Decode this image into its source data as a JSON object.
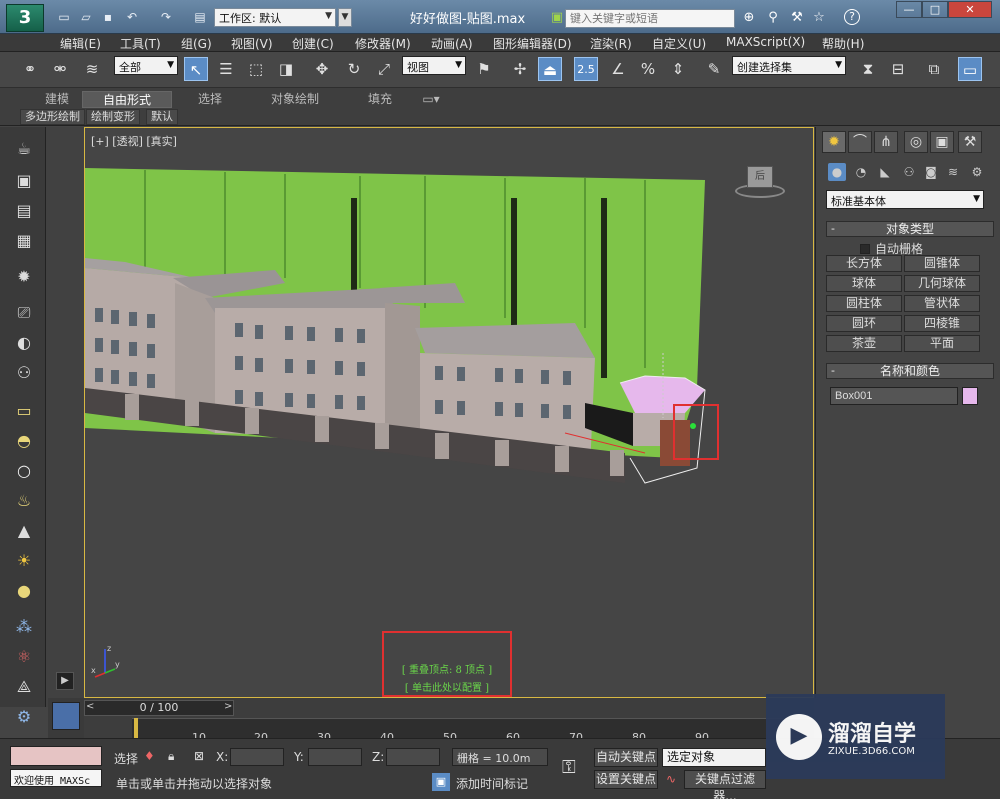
{
  "titlebar": {
    "logo_text": "3",
    "workspace_label": "工作区: 默认",
    "document_title": "好好做图-贴图.max",
    "search_placeholder": "键入关键字或短语",
    "help_label": "?"
  },
  "menu": [
    {
      "label": "编辑(E)"
    },
    {
      "label": "工具(T)"
    },
    {
      "label": "组(G)"
    },
    {
      "label": "视图(V)"
    },
    {
      "label": "创建(C)"
    },
    {
      "label": "修改器(M)"
    },
    {
      "label": "动画(A)"
    },
    {
      "label": "图形编辑器(D)"
    },
    {
      "label": "渲染(R)"
    },
    {
      "label": "自定义(U)"
    },
    {
      "label": "MAXScript(X)"
    },
    {
      "label": "帮助(H)"
    }
  ],
  "toolbar": {
    "selection_filter": "全部",
    "ref_coord": "视图",
    "snap_value": "2.5",
    "named_selection": "创建选择集"
  },
  "ribbon": {
    "tabs": [
      {
        "label": "建模"
      },
      {
        "label": "自由形式"
      },
      {
        "label": "选择"
      },
      {
        "label": "对象绘制"
      },
      {
        "label": "填充"
      }
    ],
    "subtabs": [
      {
        "label": "多边形绘制"
      },
      {
        "label": "绘制变形"
      },
      {
        "label": "默认"
      }
    ]
  },
  "viewport": {
    "label": "[+] [透视] [真实]",
    "viewcube_face": "后",
    "info_line1": "[ 重叠顶点: 8 顶点 ]",
    "info_line2": "[ 单击此处以配置 ]",
    "axis_x": "x",
    "axis_y": "y",
    "axis_z": "z"
  },
  "command_panel": {
    "category": "标准基本体",
    "object_type_title": "对象类型",
    "autogrid_label": "自动栅格",
    "object_buttons": [
      {
        "label": "长方体"
      },
      {
        "label": "圆锥体"
      },
      {
        "label": "球体"
      },
      {
        "label": "几何球体"
      },
      {
        "label": "圆柱体"
      },
      {
        "label": "管状体"
      },
      {
        "label": "圆环"
      },
      {
        "label": "四棱锥"
      },
      {
        "label": "茶壶"
      },
      {
        "label": "平面"
      }
    ],
    "name_color_title": "名称和颜色",
    "object_name": "Box001",
    "object_color": "#e6b8ec"
  },
  "timeline": {
    "slider_label": "0 / 100",
    "ticks": [
      "10",
      "20",
      "30",
      "40",
      "50",
      "60",
      "70",
      "80",
      "90"
    ]
  },
  "statusbar": {
    "welcome_text": "欢迎使用 MAXSc",
    "selection_label": "选择",
    "x_label": "X:",
    "y_label": "Y:",
    "z_label": "Z:",
    "grid_label": "栅格 = 10.0m",
    "auto_key_label": "自动关键点",
    "set_key_label": "设置关键点",
    "selected_object_label": "选定对象",
    "key_filter_label": "关键点过滤器...",
    "prompt_text": "单击或单击并拖动以选择对象",
    "add_time_tag_label": "添加时间标记"
  },
  "watermark": {
    "title": "溜溜自学",
    "url": "ZIXUE.3D66.COM"
  }
}
